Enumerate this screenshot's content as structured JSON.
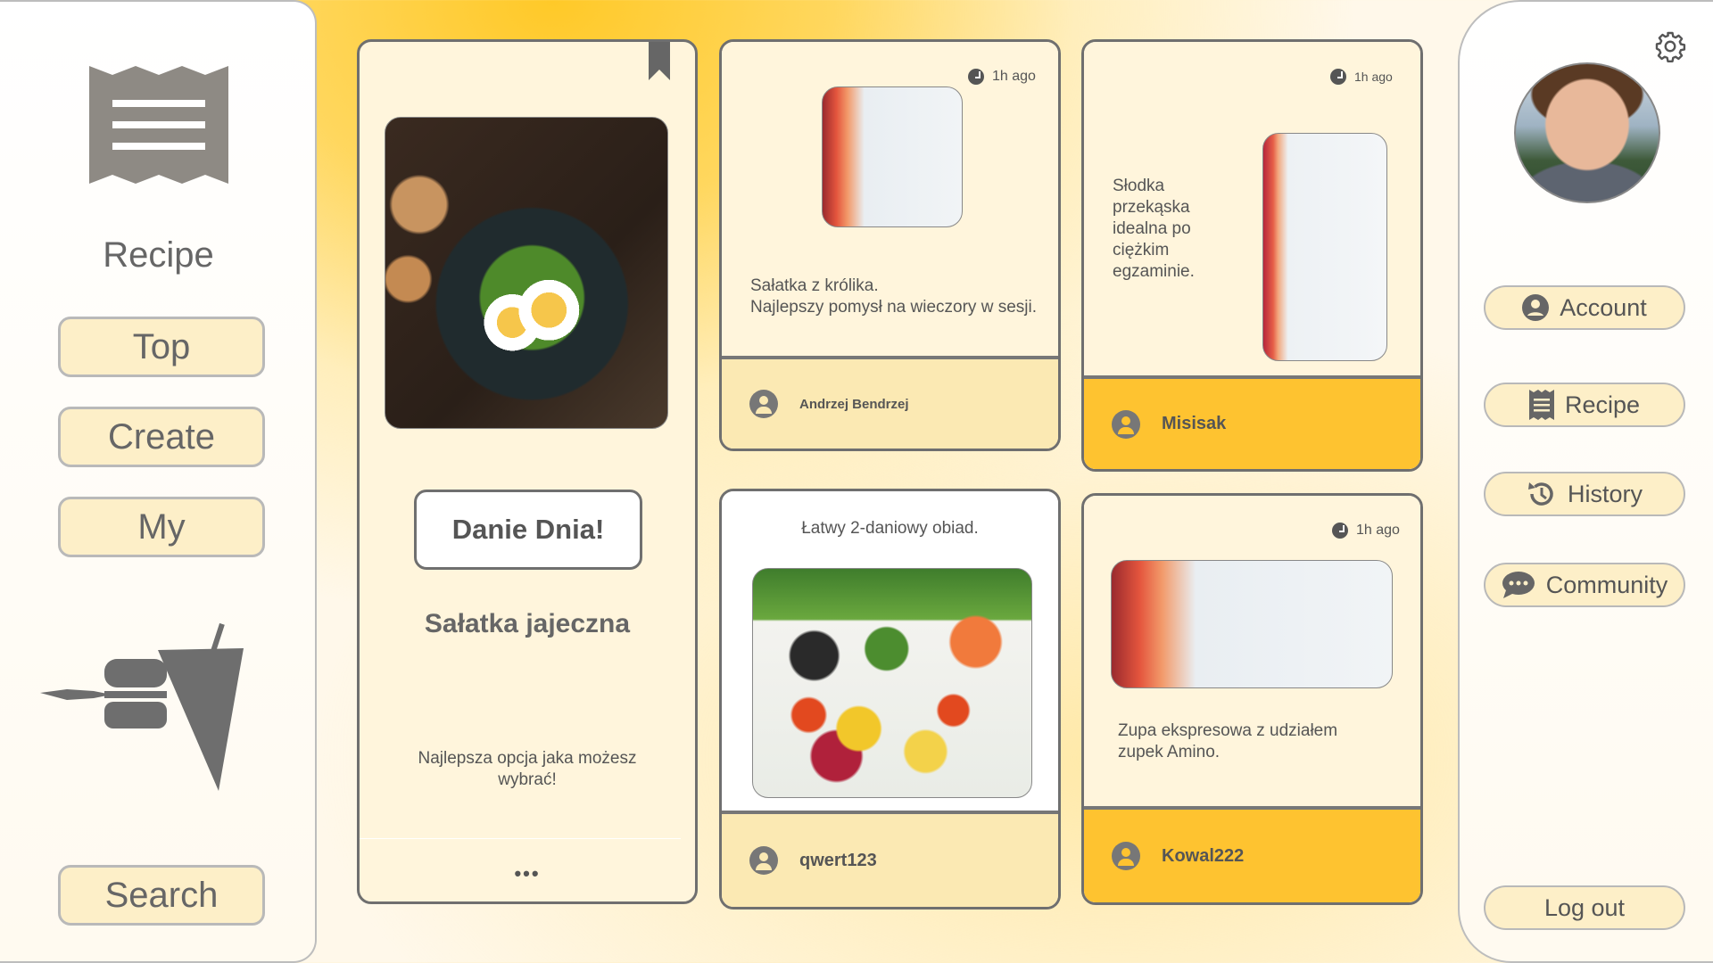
{
  "sidebar": {
    "brand": "Recipe",
    "nav": [
      {
        "label": "Top"
      },
      {
        "label": "Create"
      },
      {
        "label": "My"
      }
    ],
    "search_label": "Search"
  },
  "featured": {
    "badge": "Danie Dnia!",
    "title": "Sałatka jajeczna",
    "description": "Najlepsza opcja jaka możesz wybrać!",
    "more": "•••"
  },
  "posts": [
    {
      "time": "1h ago",
      "text": "Sałatka z królika.\nNajlepszy pomysł na wieczory w sesji.",
      "author": "Andrzej Bendrzej"
    },
    {
      "time": "1h ago",
      "text": "Słodka\nprzekąska\nidealna po\nciężkim\negzaminie.",
      "author": "Misisak"
    },
    {
      "text": "Łatwy 2-daniowy obiad.",
      "author": "qwert123"
    },
    {
      "time": "1h ago",
      "text": "Zupa ekspresowa z udziałem\nzupek Amino.",
      "author": "Kowal222"
    }
  ],
  "account_menu": {
    "items": [
      {
        "label": "Account",
        "icon": "user-circle-icon"
      },
      {
        "label": "Recipe",
        "icon": "receipt-icon"
      },
      {
        "label": "History",
        "icon": "history-icon"
      },
      {
        "label": "Community",
        "icon": "chat-bubble-icon"
      }
    ],
    "logout": "Log out"
  },
  "colors": {
    "accent": "#fec330",
    "card_bg": "#fff5dc",
    "footer_light": "#fbe9b3",
    "button_bg": "#fdefc8"
  }
}
